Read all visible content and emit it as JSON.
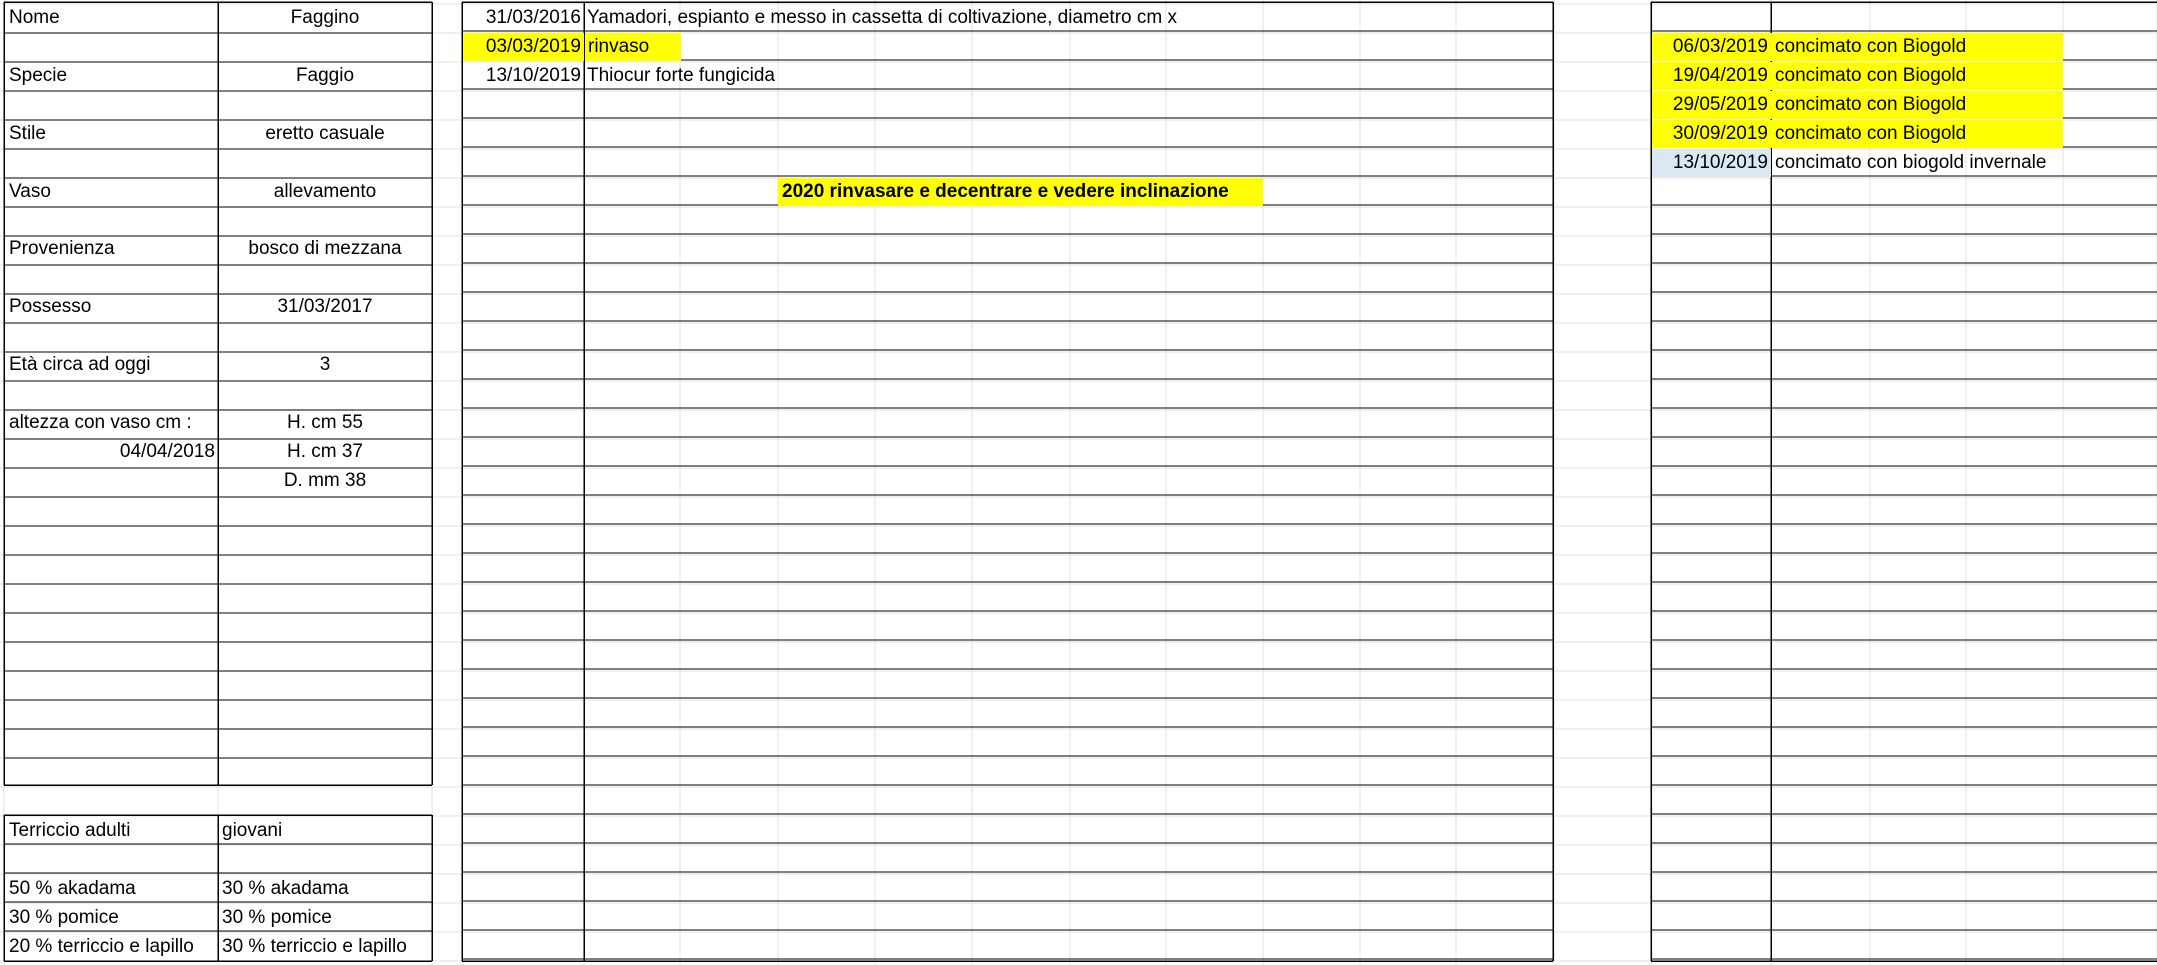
{
  "colors": {
    "highlight": "#ffff00",
    "light_blue": "#dbe8f4",
    "gridline": "#e1e1e1"
  },
  "info": {
    "rows": [
      {
        "label": "Nome",
        "value": "Faggino"
      },
      {
        "label": "Specie",
        "value": "Faggio"
      },
      {
        "label": "Stile",
        "value": "eretto casuale"
      },
      {
        "label": "Vaso",
        "value": "allevamento"
      },
      {
        "label": "Provenienza",
        "value": "bosco di mezzana"
      },
      {
        "label": "Possesso",
        "value": "31/03/2017"
      },
      {
        "label": "Età circa ad oggi",
        "value": "3"
      },
      {
        "label": "altezza con vaso cm :",
        "value": "H. cm 55"
      }
    ],
    "measure_date": "04/04/2018",
    "height": "H. cm 37",
    "diameter": "D. mm 38"
  },
  "soil": {
    "header_adult": "Terriccio adulti",
    "header_young": "giovani",
    "adult": [
      "50 % akadama",
      "30 % pomice",
      "20 % terriccio e lapillo"
    ],
    "young": [
      "30 % akadama",
      "30 % pomice",
      "30 % terriccio e lapillo"
    ]
  },
  "log": {
    "entries": [
      {
        "date": "31/03/2016",
        "text": "Yamadori, espianto e messo in cassetta di coltivazione, diametro cm x",
        "highlight": false
      },
      {
        "date": "03/03/2019",
        "text": "rinvaso",
        "highlight": true
      },
      {
        "date": "13/10/2019",
        "text": "Thiocur forte fungicida",
        "highlight": false
      }
    ],
    "note": "2020 rinvasare e decentrare e vedere inclinazione"
  },
  "fertilizer": {
    "entries": [
      {
        "date": "06/03/2019",
        "text": "concimato con Biogold",
        "fill": "yellow"
      },
      {
        "date": "19/04/2019",
        "text": "concimato con Biogold",
        "fill": "yellow"
      },
      {
        "date": "29/05/2019",
        "text": "concimato con Biogold",
        "fill": "yellow"
      },
      {
        "date": "30/09/2019",
        "text": "concimato con Biogold",
        "fill": "yellow"
      },
      {
        "date": "13/10/2019",
        "text": "concimato con biogold invernale",
        "fill": "blue"
      }
    ]
  }
}
